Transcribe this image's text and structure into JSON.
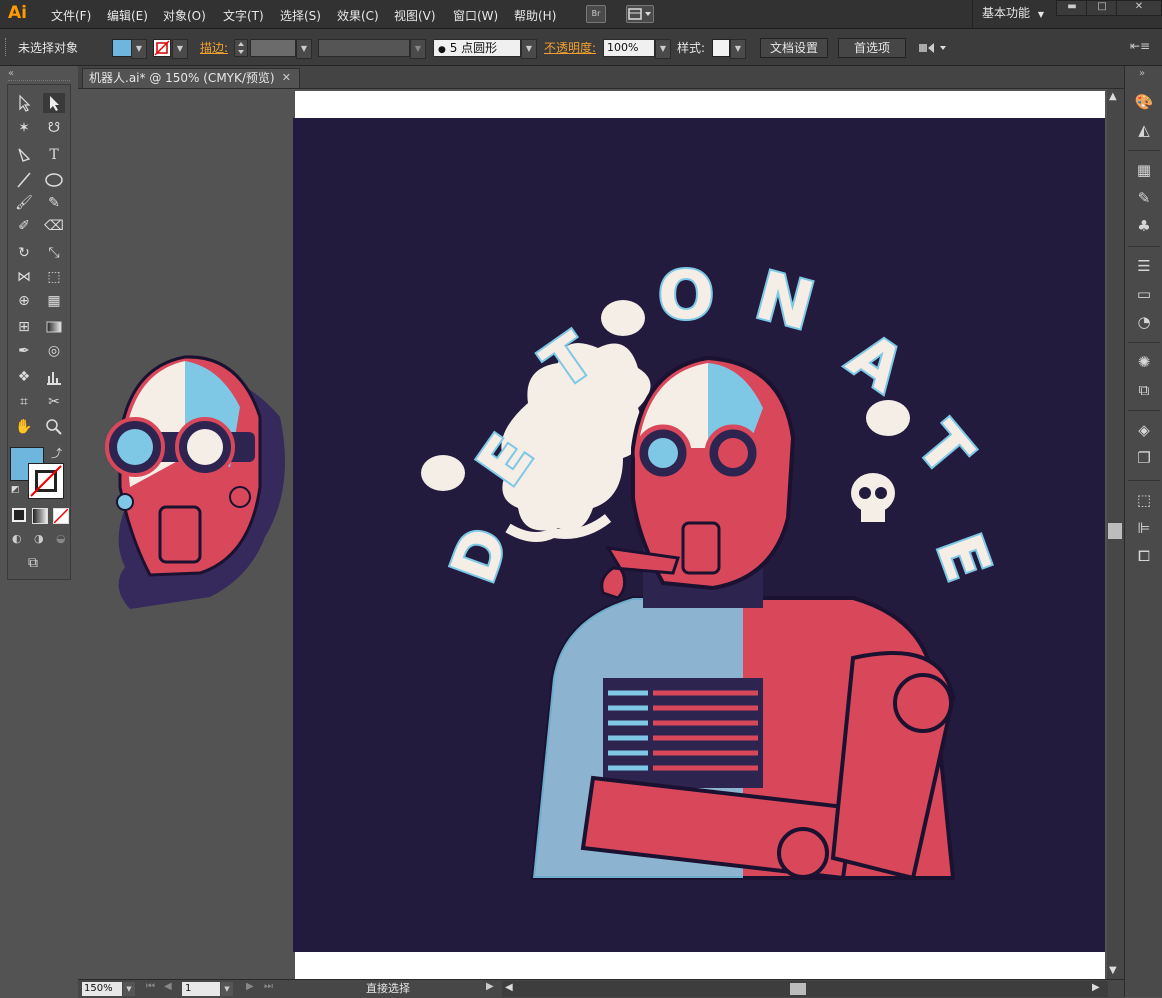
{
  "app": {
    "logo": "Ai"
  },
  "menubar": {
    "items": [
      "文件(F)",
      "编辑(E)",
      "对象(O)",
      "文字(T)",
      "选择(S)",
      "效果(C)",
      "视图(V)",
      "窗口(W)",
      "帮助(H)"
    ],
    "bridge_label": "Br",
    "workspace": "基本功能"
  },
  "controlbar": {
    "selection": "未选择对象",
    "stroke_label": "描边:",
    "brush_value": "5 点圆形",
    "opacity_label": "不透明度:",
    "opacity_value": "100%",
    "style_label": "样式:",
    "doc_setup": "文档设置",
    "preferences": "首选项"
  },
  "document": {
    "tab_title": "机器人.ai* @ 150% (CMYK/预览)"
  },
  "artwork": {
    "headline": "DETONATE"
  },
  "status": {
    "zoom": "150%",
    "artboard_num": "1",
    "current_tool": "直接选择"
  },
  "colors": {
    "fill": "#6fb6de",
    "stroke": "#ffffff",
    "background": "#231b3d",
    "robot_red": "#d9475a",
    "robot_blue": "#7ec8e6",
    "cream": "#f4eee7"
  },
  "icons": {
    "tools": [
      "selection-tool-icon",
      "direct-selection-tool-icon",
      "magic-wand-tool-icon",
      "lasso-tool-icon",
      "pen-tool-icon",
      "type-tool-icon",
      "line-tool-icon",
      "ellipse-tool-icon",
      "paintbrush-tool-icon",
      "pencil-tool-icon",
      "blob-brush-tool-icon",
      "eraser-tool-icon",
      "rotate-tool-icon",
      "scale-tool-icon",
      "width-tool-icon",
      "free-transform-tool-icon",
      "shape-builder-tool-icon",
      "perspective-grid-tool-icon",
      "mesh-tool-icon",
      "gradient-tool-icon",
      "eyedropper-tool-icon",
      "blend-tool-icon",
      "symbol-sprayer-tool-icon",
      "graph-tool-icon",
      "artboard-tool-icon",
      "slice-tool-icon",
      "hand-tool-icon",
      "zoom-tool-icon"
    ],
    "right_panels": [
      "color-panel-icon",
      "color-guide-icon",
      "swatches-icon",
      "brushes-icon",
      "symbols-icon",
      "stroke-icon",
      "gradient-icon",
      "transparency-icon",
      "appearance-icon",
      "graphic-styles-icon",
      "layers-icon",
      "artboards-icon",
      "transform-icon",
      "align-icon",
      "pathfinder-icon"
    ]
  }
}
